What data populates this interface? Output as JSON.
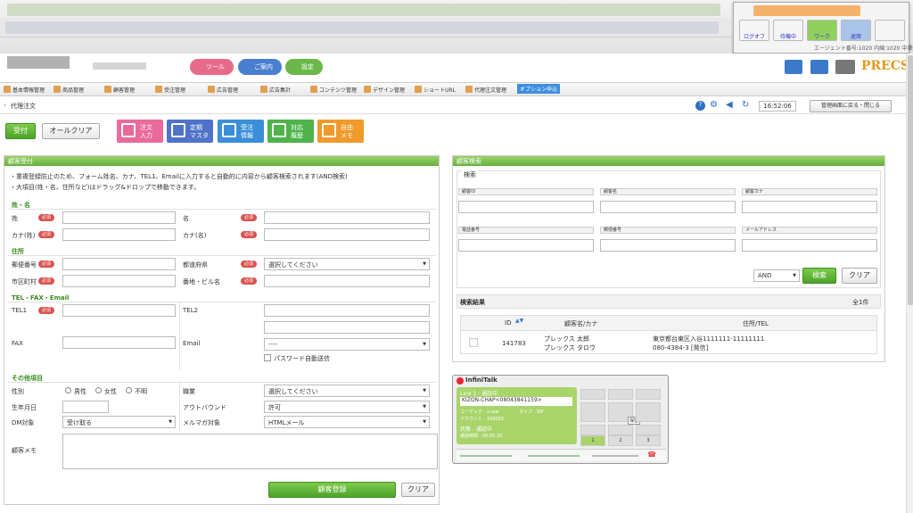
{
  "agent_panel": {
    "logout": "ログオフ",
    "away": "待機中",
    "work": "ワーク",
    "leave": "退席",
    "sub": "エージェント番号:1020 内線:1020 中澤栄一"
  },
  "header": {
    "btn1": "ツール",
    "btn2": "ご案内",
    "btn3": "設定",
    "brand": "PRECS"
  },
  "menu": [
    "基本情報管理",
    "商品管理",
    "顧客管理",
    "受注管理",
    "広告管理",
    "広告集計",
    "コンテンツ管理",
    "デザイン管理",
    "ショートURL",
    "代理注文管理",
    "オプション申込"
  ],
  "breadcrumb": "代理注文",
  "clock": "16:52:06",
  "close_admin": "管理画面に戻る・閉じる",
  "actions": {
    "accept": "受付",
    "clear_all": "オールクリア"
  },
  "icon_buttons": [
    {
      "l1": "注文",
      "l2": "入力"
    },
    {
      "l1": "定期",
      "l2": "マスタ"
    },
    {
      "l1": "受注",
      "l2": "情報"
    },
    {
      "l1": "対応",
      "l2": "履歴"
    },
    {
      "l1": "自由",
      "l2": "メモ"
    }
  ],
  "form": {
    "head": "顧客受付",
    "note1": "・重複登録防止のため、フォーム姓名、カナ、TEL1、Emailに入力すると自動的に内容から顧客検索されます(AND検索)",
    "note2": "・大項目(姓・名、住所など)はドラッグ&ドロップで移動できます。",
    "req": "必須",
    "sec_name": "姓・名",
    "sei": "姓",
    "mei": "名",
    "kana_sei": "カナ(姓)",
    "kana_mei": "カナ(名)",
    "sec_addr": "住所",
    "zip": "郵便番号",
    "pref": "都道府県",
    "pref_val": "選択してください",
    "city": "市区町村",
    "street": "番地・ビル名",
    "sec_tel": "TEL・FAX・Email",
    "tel1": "TEL1",
    "tel2": "TEL2",
    "fax": "FAX",
    "email": "Email",
    "email_sel": "----",
    "pw_auto": "パスワード自動送信",
    "sec_other": "その他項目",
    "gender": "性別",
    "male": "男性",
    "female": "女性",
    "unknown": "不明",
    "job": "職業",
    "job_val": "選択してください",
    "birth": "生年月日",
    "outbound": "アウトバウンド",
    "outbound_val": "許可",
    "dm": "DM対象",
    "dm_val": "受け取る",
    "mag": "メルマガ対象",
    "mag_val": "HTMLメール",
    "memo": "顧客メモ",
    "register": "顧客登録",
    "clear": "クリア"
  },
  "search": {
    "head": "顧客検索",
    "legend": "検索",
    "id": "顧客ID",
    "name": "顧客名",
    "kana": "顧客カナ",
    "tel": "電話番号",
    "zip": "郵便番号",
    "mail": "メールアドレス",
    "mode": "AND",
    "btn": "検索",
    "clear": "クリア",
    "result_title": "検索結果",
    "count": "全1件",
    "cols": [
      "ID",
      "顧客名/カナ",
      "住所/TEL"
    ],
    "rows": [
      {
        "id": "141783",
        "name": "プレックス 太郎",
        "kana": "プレックス タロウ",
        "addr": "東京都台東区入谷1111111-11111111",
        "tel": "080-4384-3 [発信]"
      }
    ]
  },
  "infinitalk": {
    "title": "InfiniTalk",
    "line": "Line 1 : 通話中",
    "number": "KIZON-CHAP<08043841159>",
    "codec": "コーデック : u-law",
    "type": "タイプ : SIP",
    "account": "アカウント : 100003",
    "state": "状態 : 通話中",
    "time": "通話時間 : 00:00:33",
    "hold": "保留",
    "keys": [
      "1",
      "2",
      "3"
    ]
  }
}
